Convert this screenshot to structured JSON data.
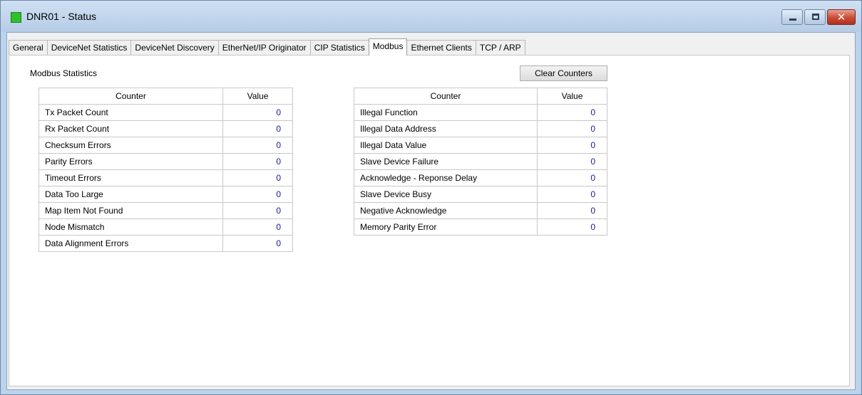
{
  "window": {
    "title": "DNR01 - Status",
    "icon": "status-green-square-icon",
    "minimize_icon": "minimize-icon",
    "maximize_icon": "maximize-icon",
    "close_icon": "close-icon",
    "close_glyph": "✕"
  },
  "tabs": [
    {
      "label": "General",
      "active": false
    },
    {
      "label": "DeviceNet Statistics",
      "active": false
    },
    {
      "label": "DeviceNet Discovery",
      "active": false
    },
    {
      "label": "EtherNet/IP Originator",
      "active": false
    },
    {
      "label": "CIP Statistics",
      "active": false
    },
    {
      "label": "Modbus",
      "active": true
    },
    {
      "label": "Ethernet Clients",
      "active": false
    },
    {
      "label": "TCP / ARP",
      "active": false
    }
  ],
  "panel": {
    "title": "Modbus Statistics",
    "clear_button": "Clear Counters"
  },
  "left_table": {
    "headers": [
      "Counter",
      "Value"
    ],
    "rows": [
      {
        "counter": "Tx Packet Count",
        "value": "0"
      },
      {
        "counter": "Rx Packet Count",
        "value": "0"
      },
      {
        "counter": "Checksum Errors",
        "value": "0"
      },
      {
        "counter": "Parity Errors",
        "value": "0"
      },
      {
        "counter": "Timeout Errors",
        "value": "0"
      },
      {
        "counter": "Data Too Large",
        "value": "0"
      },
      {
        "counter": "Map Item Not Found",
        "value": "0"
      },
      {
        "counter": "Node Mismatch",
        "value": "0"
      },
      {
        "counter": "Data Alignment Errors",
        "value": "0"
      }
    ]
  },
  "right_table": {
    "headers": [
      "Counter",
      "Value"
    ],
    "rows": [
      {
        "counter": "Illegal Function",
        "value": "0"
      },
      {
        "counter": "Illegal Data Address",
        "value": "0"
      },
      {
        "counter": "Illegal Data Value",
        "value": "0"
      },
      {
        "counter": "Slave Device Failure",
        "value": "0"
      },
      {
        "counter": "Acknowledge - Reponse Delay",
        "value": "0"
      },
      {
        "counter": "Slave Device Busy",
        "value": "0"
      },
      {
        "counter": "Negative Acknowledge",
        "value": "0"
      },
      {
        "counter": "Memory Parity Error",
        "value": "0"
      }
    ]
  },
  "colors": {
    "value_text": "#1a1aa6",
    "status_icon": "#2fc12b",
    "close_button": "#c94a35"
  }
}
